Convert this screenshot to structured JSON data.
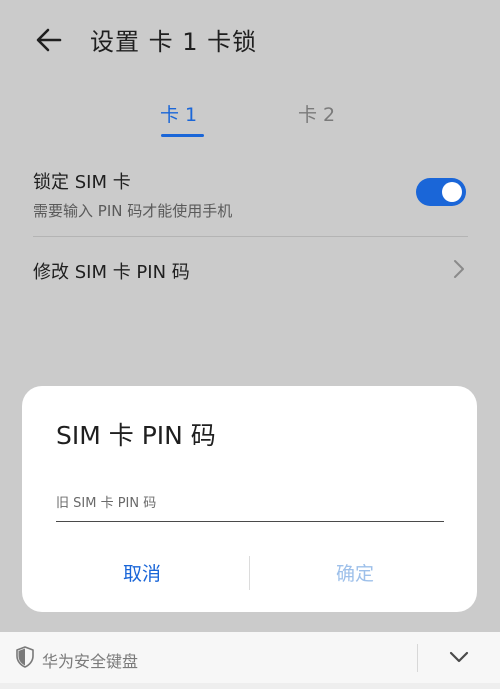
{
  "header": {
    "title": "设置 卡 1 卡锁",
    "back_icon": "arrow-left-icon"
  },
  "tabs": [
    {
      "label": "卡 1",
      "active": true
    },
    {
      "label": "卡 2",
      "active": false
    }
  ],
  "lock_sim": {
    "label": "锁定 SIM 卡",
    "description": "需要输入 PIN 码才能使用手机",
    "enabled": true
  },
  "change_pin": {
    "label": "修改 SIM 卡 PIN 码",
    "chevron_icon": "chevron-right-icon"
  },
  "dialog": {
    "title": "SIM 卡 PIN 码",
    "input": {
      "value": "",
      "placeholder": "旧 SIM 卡 PIN 码"
    },
    "cancel_label": "取消",
    "ok_label": "确定"
  },
  "keyboard": {
    "label": "华为安全键盘",
    "shield_icon": "shield-icon",
    "collapse_icon": "chevron-down-icon"
  },
  "colors": {
    "accent": "#1a66d8",
    "disabled_accent": "#9ec0ea",
    "overlay": "#cbcbcb"
  }
}
